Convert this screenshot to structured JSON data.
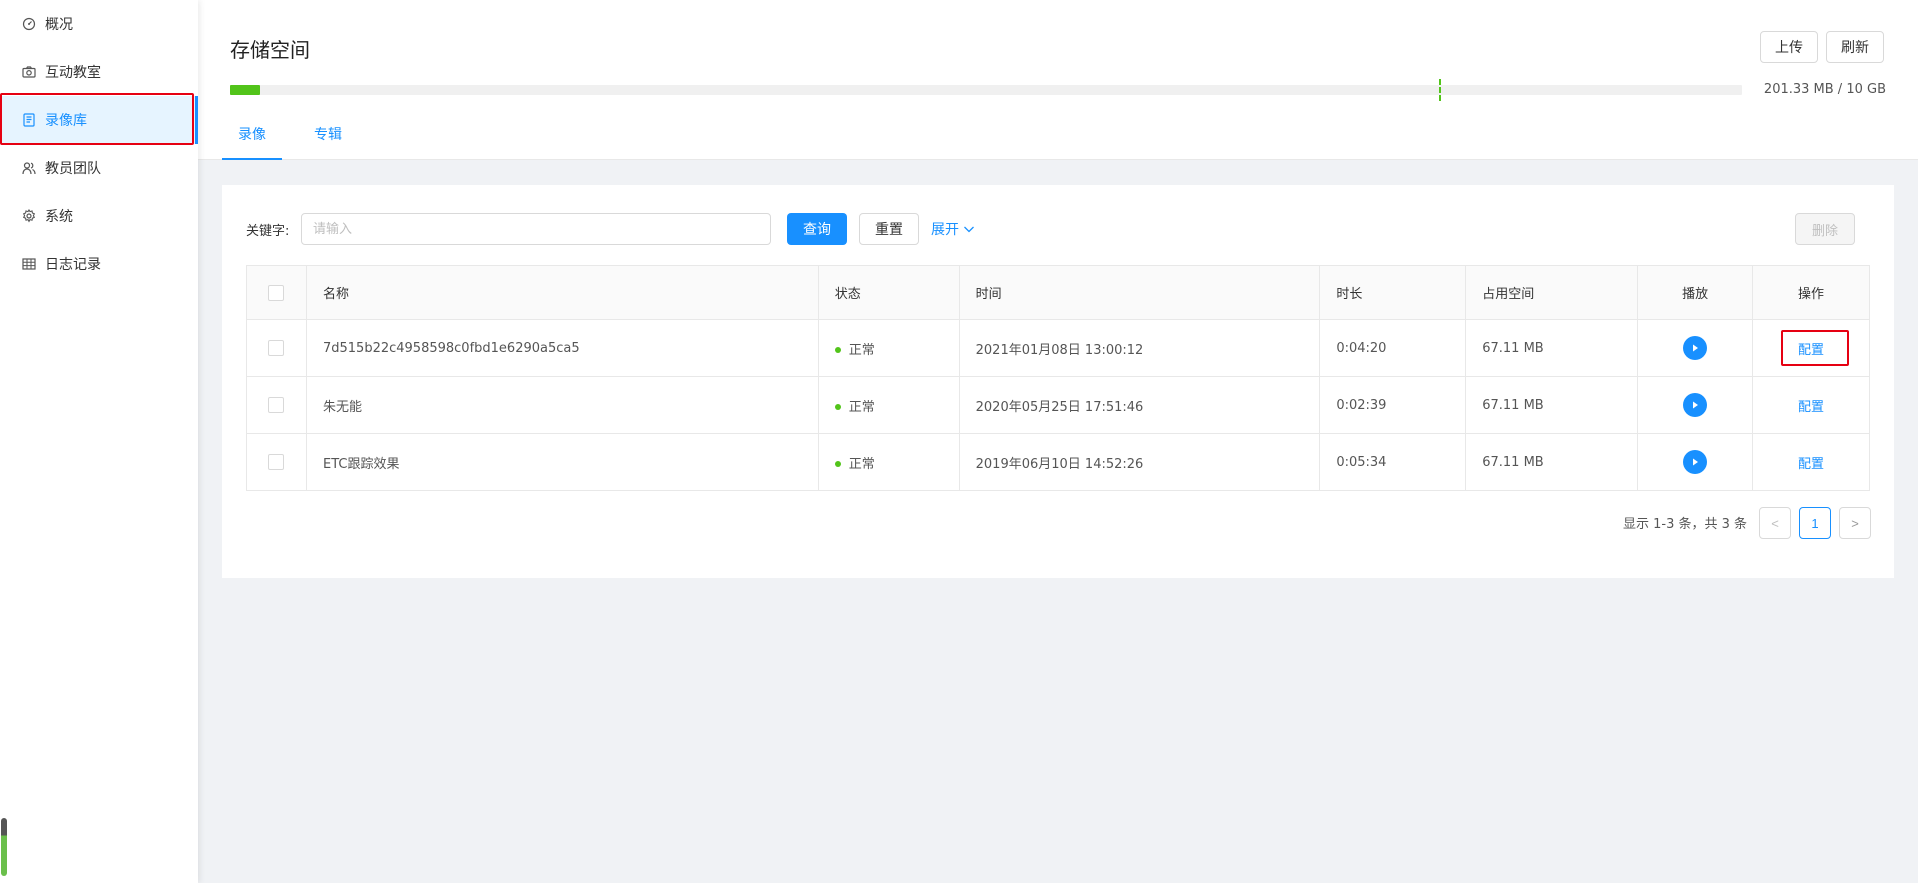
{
  "sidebar": {
    "items": [
      {
        "label": "概况",
        "icon": "dashboard-icon"
      },
      {
        "label": "互动教室",
        "icon": "camera-icon"
      },
      {
        "label": "录像库",
        "icon": "book-icon",
        "active": true
      },
      {
        "label": "教员团队",
        "icon": "team-icon"
      },
      {
        "label": "系统",
        "icon": "gear-icon"
      },
      {
        "label": "日志记录",
        "icon": "table-icon"
      }
    ]
  },
  "header": {
    "title": "存储空间",
    "upload_label": "上传",
    "refresh_label": "刷新",
    "storage_text": "201.33 MB / 10 GB",
    "storage_used_fraction": 0.02,
    "tabs": [
      {
        "label": "录像",
        "active": true
      },
      {
        "label": "专辑",
        "active": false
      }
    ]
  },
  "filters": {
    "keyword_label": "关键字:",
    "keyword_placeholder": "请输入",
    "keyword_value": "",
    "query_label": "查询",
    "reset_label": "重置",
    "expand_label": "展开",
    "delete_label": "删除"
  },
  "table": {
    "columns": [
      "名称",
      "状态",
      "时间",
      "时长",
      "占用空间",
      "播放",
      "操作"
    ],
    "rows": [
      {
        "name": "7d515b22c4958598c0fbd1e6290a5ca5",
        "status": "正常",
        "time": "2021年01月08日 13:00:12",
        "duration": "0:04:20",
        "size": "67.11 MB",
        "action": "配置"
      },
      {
        "name": "朱无能",
        "status": "正常",
        "time": "2020年05月25日 17:51:46",
        "duration": "0:02:39",
        "size": "67.11 MB",
        "action": "配置"
      },
      {
        "name": "ETC跟踪效果",
        "status": "正常",
        "time": "2019年06月10日 14:52:26",
        "duration": "0:05:34",
        "size": "67.11 MB",
        "action": "配置"
      }
    ]
  },
  "pagination": {
    "summary": "显示 1-3 条，共 3 条",
    "current_page": "1",
    "prev": "<",
    "next": ">"
  },
  "colors": {
    "primary": "#1890ff",
    "success": "#52c41a",
    "highlight": "#e60012"
  }
}
